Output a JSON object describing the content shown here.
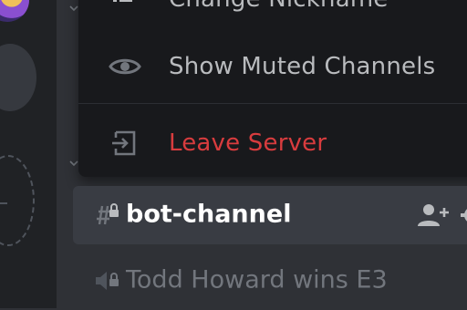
{
  "context_menu": {
    "items": [
      {
        "label": "Change Nickname",
        "icon": "pencil-icon"
      },
      {
        "label": "Show Muted Channels",
        "icon": "eye-icon"
      },
      {
        "label": "Leave Server",
        "icon": "leave-icon",
        "color": "#d83c3e"
      }
    ]
  },
  "channels": [
    {
      "name": "bot-channel",
      "type": "locked-text-channel",
      "state": "selected"
    },
    {
      "name": "Todd Howard wins E3",
      "type": "locked-voice-channel",
      "state": "muted"
    }
  ],
  "colors": {
    "background": "#2f3136",
    "menu_background": "#18191c",
    "danger": "#d83c3e",
    "selected_row": "#393c43",
    "muted_text": "#72767d"
  }
}
